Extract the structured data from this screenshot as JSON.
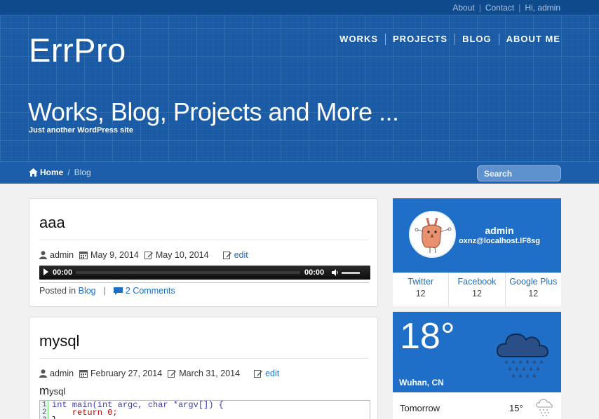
{
  "topbar": {
    "links": [
      "About",
      "Contact",
      "Hi, admin"
    ]
  },
  "site": {
    "title": "ErrPro",
    "tagline": "Works, Blog, Projects and More ...",
    "description": "Just another WordPress site"
  },
  "nav": {
    "items": [
      "WORKS",
      "PROJECTS",
      "BLOG",
      "ABOUT ME"
    ]
  },
  "breadcrumb": {
    "home": "Home",
    "separator": "/",
    "current": "Blog"
  },
  "search": {
    "placeholder": "Search"
  },
  "posts": [
    {
      "title": "aaa",
      "author": "admin",
      "date": "May 9, 2014",
      "modified": "May 10, 2014",
      "edit": "edit",
      "audio": {
        "current": "00:00",
        "duration": "00:00"
      },
      "posted_in_label": "Posted in",
      "category": "Blog",
      "separator": "|",
      "comments": "2 Comments"
    },
    {
      "title": "mysql",
      "author": "admin",
      "date": "February 27, 2014",
      "modified": "March 31, 2014",
      "edit": "edit",
      "excerpt_first": "m",
      "excerpt_rest": "ysql",
      "code": {
        "line_numbers": [
          "1",
          "2",
          "3"
        ],
        "lines": [
          "int main(int argc, char *argv[]) {",
          "    return 0;",
          "}"
        ]
      }
    }
  ],
  "profile": {
    "name": "admin",
    "email": "oxnz@localhost.lF8sg",
    "stats": [
      {
        "label": "Twitter",
        "value": "12"
      },
      {
        "label": "Facebook",
        "value": "12"
      },
      {
        "label": "Google Plus",
        "value": "12"
      }
    ]
  },
  "weather": {
    "temp": "18°",
    "city": "Wuhan, CN",
    "forecast_label": "Tomorrow",
    "forecast_temp": "15°"
  },
  "colors": {
    "header": "#1a5ba6",
    "accent": "#1f6fc9",
    "link": "#1a6fc4"
  }
}
